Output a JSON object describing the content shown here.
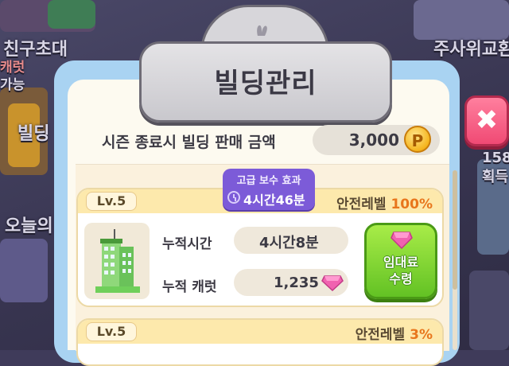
{
  "background": {
    "left_top_label": "친구초대",
    "left_side_label_1": "캐럿",
    "left_side_label_2": "가능",
    "left_mid_label": "빌딩",
    "left_bottom_label": "오늘의",
    "right_top_label": "주사위교환",
    "right_mid_label_1": "158",
    "right_mid_label_2": "획득"
  },
  "dialog": {
    "title": "빌딩관리",
    "season_end_sale_label": "시즌 종료시 빌딩 판매 금액",
    "season_end_sale_value": "3,000",
    "coin_icon": "coin-p-icon",
    "coin_letter": "P",
    "close_icon": "close-x-icon"
  },
  "buildings": [
    {
      "level": "Lv.5",
      "safety_label": "안전레벨",
      "safety_value": "100%",
      "bonus_title": "고급 보수 효과",
      "bonus_time": "4시간46분",
      "accumulated_time_label": "누적시간",
      "accumulated_time_value": "4시간8분",
      "accumulated_carat_label": "누적 캐럿",
      "accumulated_carat_value": "1,235",
      "rent_button_line1": "임대료",
      "rent_button_line2": "수령"
    },
    {
      "level": "Lv.5",
      "safety_label": "안전레벨",
      "safety_value": "3%"
    }
  ],
  "colors": {
    "panel_blue": "#a9d3f2",
    "header_yellow": "#fde9ac",
    "bonus_purple": "#7c5bd8",
    "rent_green": "#63c224",
    "close_pink": "#f04a74",
    "accent_orange": "#e8761c",
    "gem_pink": "#f062b0"
  }
}
